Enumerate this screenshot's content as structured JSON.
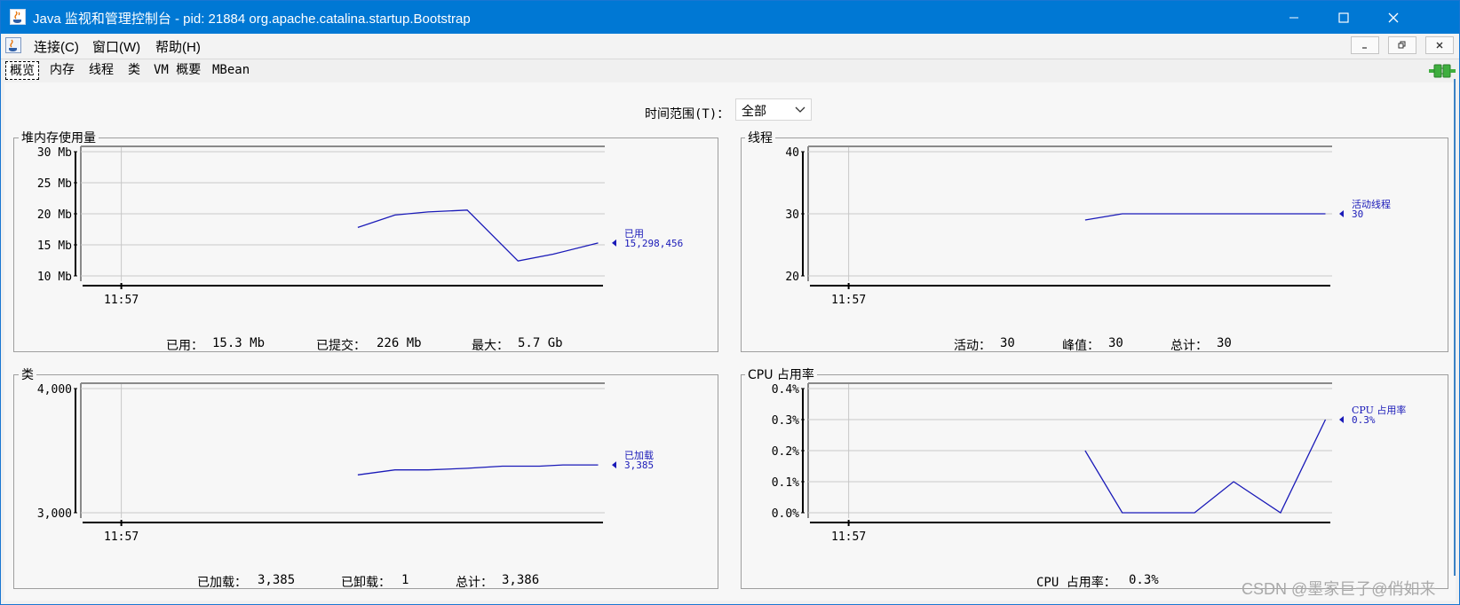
{
  "window": {
    "title": "Java 监视和管理控制台 - pid: 21884 org.apache.catalina.startup.Bootstrap",
    "minimize_icon": "minimize-icon",
    "maximize_icon": "maximize-icon",
    "close_icon": "close-icon"
  },
  "menu": {
    "items": [
      "连接(C)",
      "窗口(W)",
      "帮助(H)"
    ],
    "inner_controls": [
      "inner-minimize-icon",
      "inner-restore-icon",
      "inner-close-icon"
    ]
  },
  "tabs": [
    "概览",
    "内存",
    "线程",
    "类",
    "VM 概要",
    "MBean"
  ],
  "selected_tab": "概览",
  "time_range": {
    "label": "时间范围(T)：",
    "value": "全部"
  },
  "panels": {
    "heap": {
      "title": "堆内存使用量",
      "stats": [
        {
          "label": "已用：",
          "value": "15.3  Mb"
        },
        {
          "label": "已提交：",
          "value": "226  Mb"
        },
        {
          "label": "最大：",
          "value": "5.7  Gb"
        }
      ]
    },
    "threads": {
      "title": "线程",
      "stats": [
        {
          "label": "活动：",
          "value": "30"
        },
        {
          "label": "峰值：",
          "value": "30"
        },
        {
          "label": "总计：",
          "value": "30"
        }
      ]
    },
    "classes": {
      "title": "类",
      "stats": [
        {
          "label": "已加载：",
          "value": "3,385"
        },
        {
          "label": "已卸载：",
          "value": "1"
        },
        {
          "label": "总计：",
          "value": "3,386"
        }
      ]
    },
    "cpu": {
      "title": "CPU 占用率",
      "stats": [
        {
          "label": "CPU 占用率：",
          "value": "0.3%"
        }
      ]
    }
  },
  "chart_data": [
    {
      "type": "line",
      "title": "堆内存使用量",
      "y_ticks": [
        "30 Mb",
        "25 Mb",
        "20 Mb",
        "15 Mb",
        "10 Mb"
      ],
      "y_tick_values": [
        30,
        25,
        20,
        15,
        10
      ],
      "ylim": [
        10,
        30
      ],
      "y_unit": "Mb",
      "x_tick_labels": [
        "11:57"
      ],
      "x_tick_minutes": [
        0
      ],
      "x_range_minutes": [
        -0.36,
        4.93
      ],
      "series": [
        {
          "name": "已用",
          "value_label": "15,298,456",
          "x_minutes": [
            2.42,
            2.8,
            3.14,
            3.54,
            4.06,
            4.42,
            4.88
          ],
          "y": [
            17.8,
            19.8,
            20.3,
            20.6,
            12.4,
            13.5,
            15.3
          ]
        }
      ]
    },
    {
      "type": "line",
      "title": "线程",
      "y_ticks": [
        "40",
        "30",
        "20"
      ],
      "y_tick_values": [
        40,
        30,
        20
      ],
      "ylim": [
        20,
        40
      ],
      "x_tick_labels": [
        "11:57"
      ],
      "x_tick_minutes": [
        0
      ],
      "x_range_minutes": [
        -0.36,
        4.93
      ],
      "series": [
        {
          "name": "活动线程",
          "value_label": "30",
          "x_minutes": [
            2.42,
            2.8,
            4.88
          ],
          "y": [
            29,
            30,
            30
          ]
        }
      ]
    },
    {
      "type": "line",
      "title": "类",
      "y_ticks": [
        "4,000",
        "3,000"
      ],
      "y_tick_values": [
        4000,
        3000
      ],
      "ylim": [
        3000,
        4000
      ],
      "x_tick_labels": [
        "11:57"
      ],
      "x_tick_minutes": [
        0
      ],
      "x_range_minutes": [
        -0.36,
        4.93
      ],
      "series": [
        {
          "name": "已加载",
          "value_label": "3,385",
          "x_minutes": [
            2.42,
            2.8,
            3.14,
            3.54,
            3.9,
            4.28,
            4.52,
            4.88
          ],
          "y": [
            3305,
            3345,
            3345,
            3358,
            3375,
            3375,
            3385,
            3385
          ]
        }
      ]
    },
    {
      "type": "line",
      "title": "CPU 占用率",
      "y_ticks": [
        "0.4%",
        "0.3%",
        "0.2%",
        "0.1%",
        "0.0%"
      ],
      "y_tick_values": [
        0.4,
        0.3,
        0.2,
        0.1,
        0.0
      ],
      "ylim": [
        0,
        0.4
      ],
      "y_unit": "%",
      "x_tick_labels": [
        "11:57"
      ],
      "x_tick_minutes": [
        0
      ],
      "x_range_minutes": [
        -0.36,
        4.93
      ],
      "series": [
        {
          "name": "CPU 占用率",
          "value_label": "0.3%",
          "x_minutes": [
            2.42,
            2.8,
            3.54,
            3.94,
            4.42,
            4.88
          ],
          "y": [
            0.2,
            0.0,
            0.0,
            0.1,
            0.0,
            0.3
          ]
        }
      ]
    }
  ],
  "colors": {
    "titlebar": "#0078d4",
    "series_line": "#1a1ab8",
    "series_label": "#1a1ab8",
    "grid": "#c8c8c8",
    "plot_bg": "#f7f7f7",
    "connection_icon": "#3fae3f"
  },
  "watermark": "CSDN @墨家巨子@俏如来"
}
